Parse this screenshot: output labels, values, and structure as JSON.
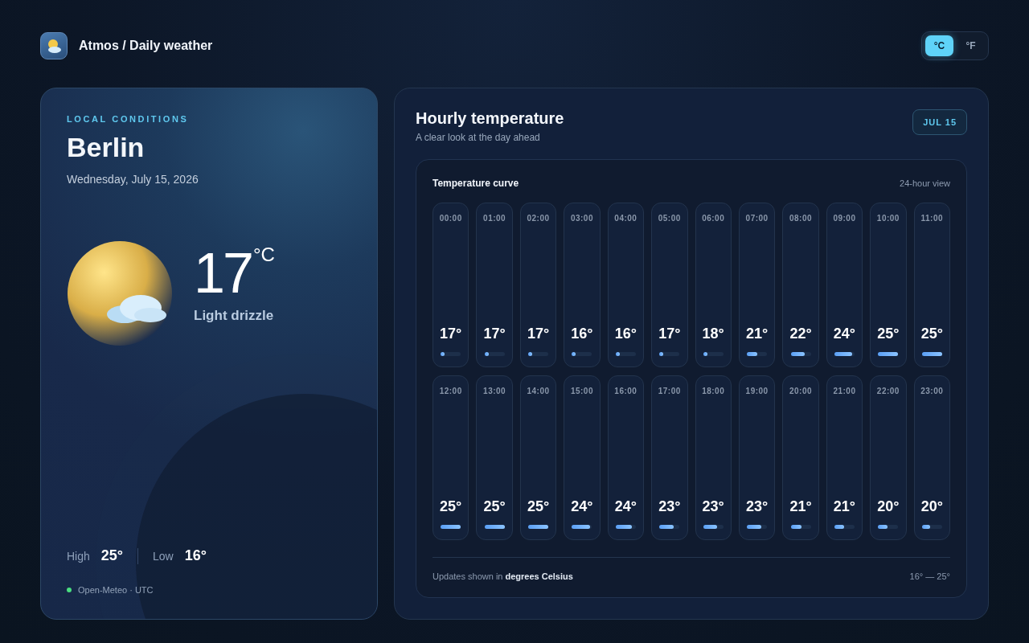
{
  "header": {
    "title": "Atmos / Daily weather",
    "units": [
      {
        "label": "°C",
        "selected": true
      },
      {
        "label": "°F",
        "selected": false
      }
    ]
  },
  "current": {
    "eyebrow": "LOCAL CONDITIONS",
    "city": "Berlin",
    "date": "Wednesday, July 15, 2026",
    "temperature": "17",
    "unit": "°C",
    "condition": "Light drizzle",
    "high_label": "High",
    "high": "25°",
    "low_label": "Low",
    "low": "16°",
    "source": "Open-Meteo · UTC"
  },
  "hourly": {
    "title": "Hourly temperature",
    "subtitle": "A clear look at the day ahead",
    "date_badge": "JUL 15",
    "panel_title": "Temperature curve",
    "panel_note": "24-hour view",
    "hours": [
      {
        "time": "00:00",
        "temp": "17°",
        "level": 0.2
      },
      {
        "time": "01:00",
        "temp": "17°",
        "level": 0.2
      },
      {
        "time": "02:00",
        "temp": "17°",
        "level": 0.2
      },
      {
        "time": "03:00",
        "temp": "16°",
        "level": 0.12
      },
      {
        "time": "04:00",
        "temp": "16°",
        "level": 0.12
      },
      {
        "time": "05:00",
        "temp": "17°",
        "level": 0.2
      },
      {
        "time": "06:00",
        "temp": "18°",
        "level": 0.22
      },
      {
        "time": "07:00",
        "temp": "21°",
        "level": 0.5
      },
      {
        "time": "08:00",
        "temp": "22°",
        "level": 0.7
      },
      {
        "time": "09:00",
        "temp": "24°",
        "level": 0.9
      },
      {
        "time": "10:00",
        "temp": "25°",
        "level": 1
      },
      {
        "time": "11:00",
        "temp": "25°",
        "level": 1
      },
      {
        "time": "12:00",
        "temp": "25°",
        "level": 1
      },
      {
        "time": "13:00",
        "temp": "25°",
        "level": 1
      },
      {
        "time": "14:00",
        "temp": "25°",
        "level": 1
      },
      {
        "time": "15:00",
        "temp": "24°",
        "level": 0.9
      },
      {
        "time": "16:00",
        "temp": "24°",
        "level": 0.8
      },
      {
        "time": "17:00",
        "temp": "23°",
        "level": 0.7
      },
      {
        "time": "18:00",
        "temp": "23°",
        "level": 0.7
      },
      {
        "time": "19:00",
        "temp": "23°",
        "level": 0.7
      },
      {
        "time": "20:00",
        "temp": "21°",
        "level": 0.55
      },
      {
        "time": "21:00",
        "temp": "21°",
        "level": 0.5
      },
      {
        "time": "22:00",
        "temp": "20°",
        "level": 0.45
      },
      {
        "time": "23:00",
        "temp": "20°",
        "level": 0.4
      }
    ],
    "footer_note": "Updates shown in **degrees Celsius**",
    "range": "16° — 25°"
  }
}
